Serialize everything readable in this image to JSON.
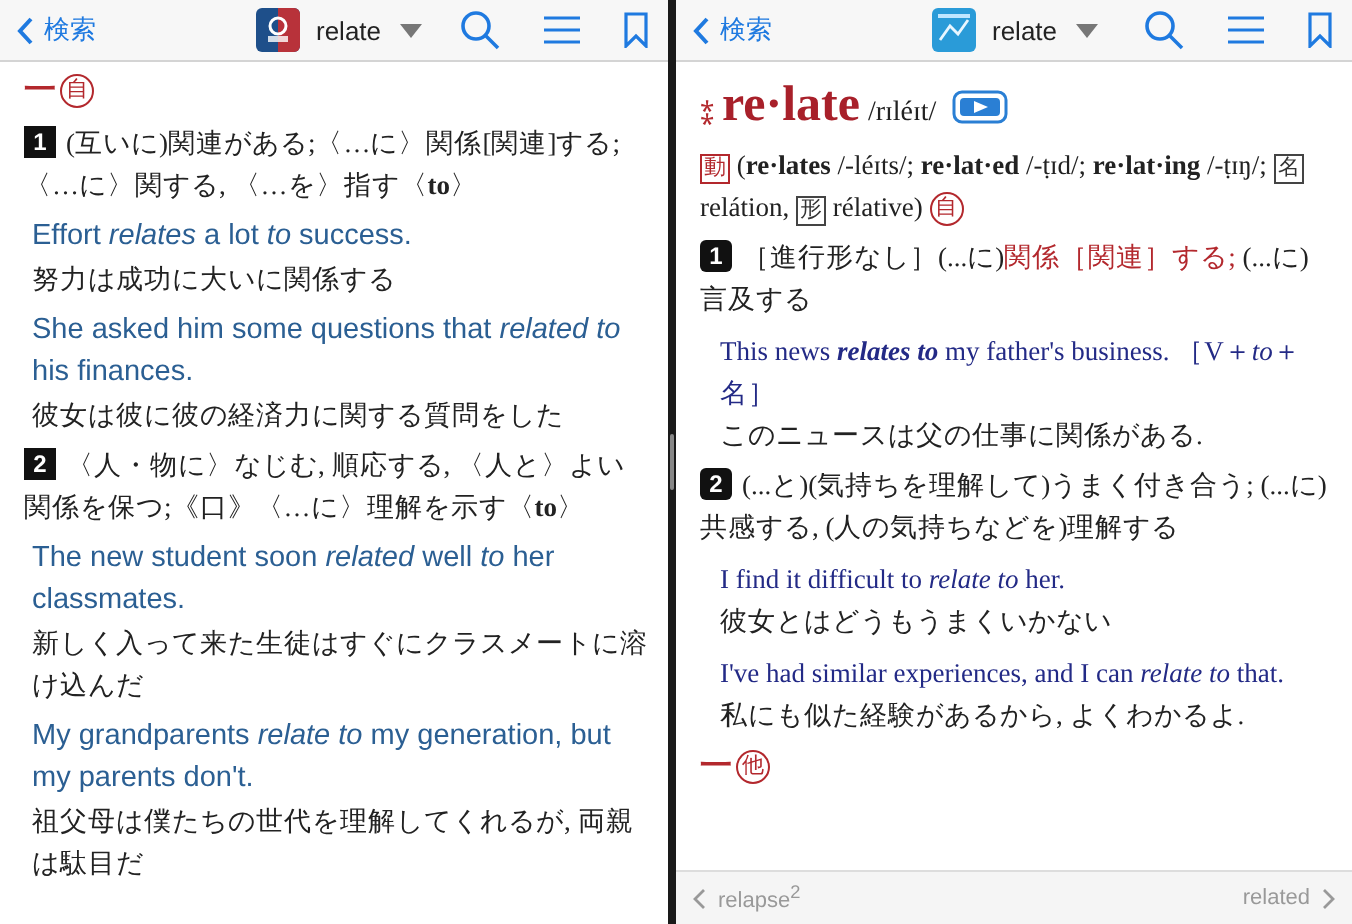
{
  "panes": [
    {
      "kind": "sans",
      "nav": {
        "back": "検索",
        "word": "relate"
      },
      "blocks": [
        {
          "kind": "pos",
          "dash": "一",
          "mark": "自"
        },
        {
          "kind": "sense",
          "num": "1",
          "segments": [
            {
              "kind": "text",
              "text": "(互いに)関連がある;〈…に〉関係[関連]する;〈…に〉関する, 〈…を〉指す〈**to**〉"
            }
          ]
        },
        {
          "kind": "example",
          "en": "Effort *relates* a lot *to* success.",
          "ja": "努力は成功に大いに関係する"
        },
        {
          "kind": "example",
          "en": "She asked him some questions that *related to* his finances.",
          "ja": "彼女は彼に彼の経済力に関する質問をした"
        },
        {
          "kind": "sense",
          "num": "2",
          "segments": [
            {
              "kind": "text",
              "text": "〈人・物に〉なじむ, 順応する, 〈人と〉よい関係を保つ;《口》〈…に〉理解を示す〈**to**〉"
            }
          ]
        },
        {
          "kind": "example",
          "en": "The new student soon *related* well *to* her classmates.",
          "ja": "新しく入って来た生徒はすぐにクラスメートに溶け込んだ"
        },
        {
          "kind": "example",
          "en": "My grandparents *relate to* my generation, but my parents don't.",
          "ja": "祖父母は僕たちの世代を理解してくれるが, 両親は駄目だ"
        }
      ]
    },
    {
      "kind": "serif",
      "nav": {
        "back": "検索",
        "word": "relate"
      },
      "blocks": [
        {
          "kind": "headword",
          "mark": "⁑",
          "word": "re·late",
          "pron": "/rɪléɪt/"
        },
        {
          "kind": "forms",
          "segments": [
            {
              "kind": "box",
              "text": "動"
            },
            {
              "kind": "text",
              "text": " (**re·lates** /-léɪts/; **re·lat·ed** /-ṭɪd/; **re·lat·ing** /-ṭɪŋ/; "
            },
            {
              "kind": "box",
              "text": "名"
            },
            {
              "kind": "text",
              "text": " relátion, "
            },
            {
              "kind": "box",
              "text": "形"
            },
            {
              "kind": "text",
              "text": " rélative) "
            },
            {
              "kind": "circle",
              "text": "自"
            }
          ]
        },
        {
          "kind": "sense",
          "num": "1",
          "segments": [
            {
              "kind": "text",
              "text": "［進行形なし］(...に)"
            },
            {
              "kind": "red",
              "text": "関係［関連］する;"
            },
            {
              "kind": "text",
              "text": " (...に)言及する"
            }
          ]
        },
        {
          "kind": "example",
          "en": "This news **relates to** my father's business. ［V＋*to*＋名］",
          "ja": "このニュースは父の仕事に関係がある."
        },
        {
          "kind": "sense",
          "num": "2",
          "segments": [
            {
              "kind": "text",
              "text": "(...と)(気持ちを理解して)うまく付き合う; (...に)共感する, (人の気持ちなどを)理解する"
            }
          ]
        },
        {
          "kind": "example",
          "en": "I find it difficult to *relate to* her.",
          "ja": "彼女とはどうもうまくいかない"
        },
        {
          "kind": "example",
          "en": "I've had similar experiences, and I can *relate to* that.",
          "ja": "私にも似た経験があるから, よくわかるよ."
        },
        {
          "kind": "pos",
          "dash": "一",
          "mark": "他"
        }
      ],
      "footer": {
        "prev": "relapse$^{2}$",
        "next": "related"
      }
    }
  ]
}
